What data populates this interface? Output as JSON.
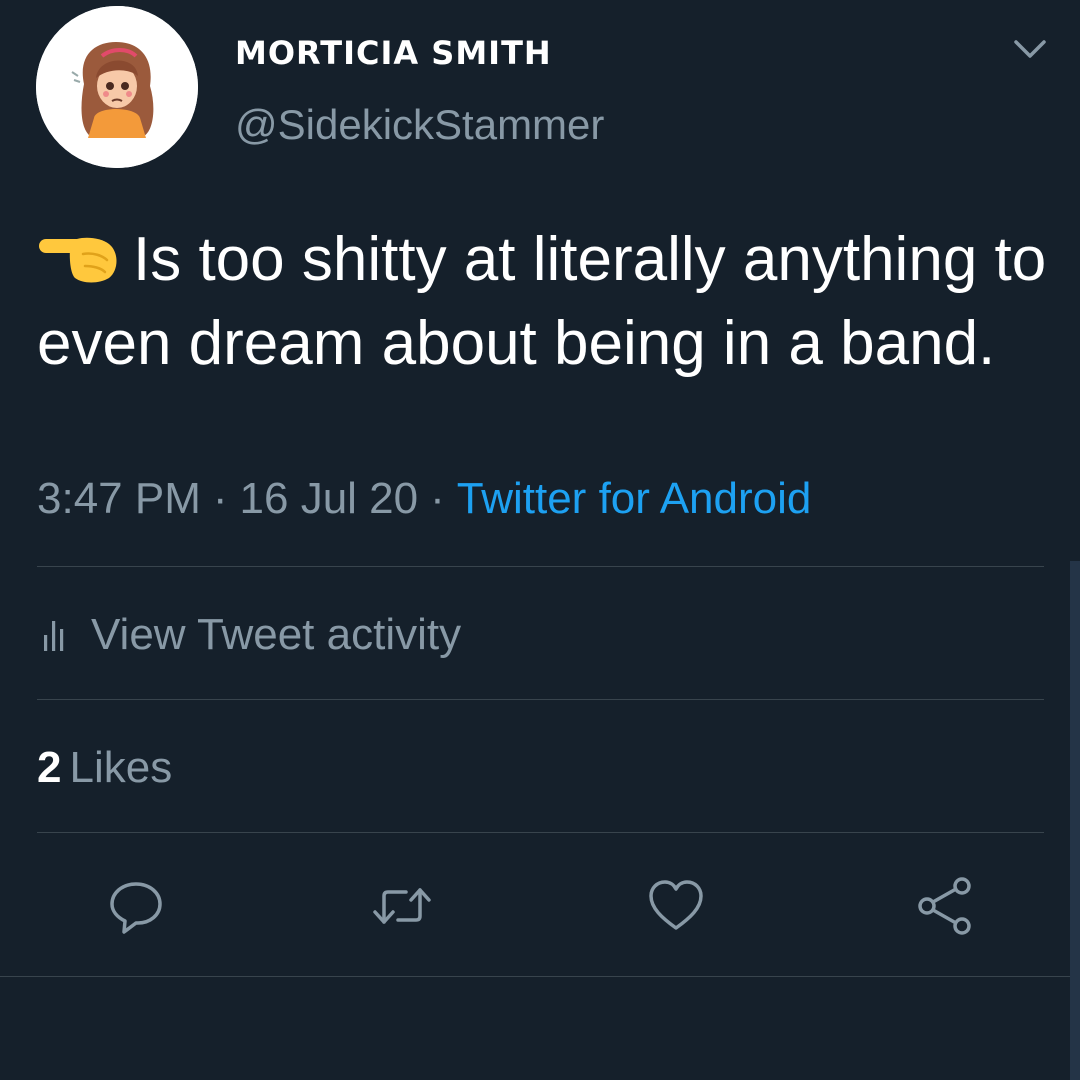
{
  "author": {
    "display_name": "MORTICIA SMITH",
    "handle": "@SidekickStammer"
  },
  "tweet": {
    "text": "Is too shitty at literally anything to even dream about being in a band.",
    "leading_icon": "backhand-index-pointing-right-icon"
  },
  "meta": {
    "time": "3:47 PM",
    "separator": "·",
    "date": "16 Jul 20",
    "source": "Twitter for Android"
  },
  "activity": {
    "label": "View Tweet activity",
    "icon": "bar-chart-icon"
  },
  "likes": {
    "count": "2",
    "label": "Likes"
  },
  "actions": [
    "reply-icon",
    "retweet-icon",
    "like-icon",
    "share-icon"
  ],
  "colors": {
    "background": "#15202b",
    "primary_text": "#ffffff",
    "secondary_text": "#8899a6",
    "link": "#1da1f2",
    "divider": "#38444d",
    "emoji": "#ffc83d"
  }
}
